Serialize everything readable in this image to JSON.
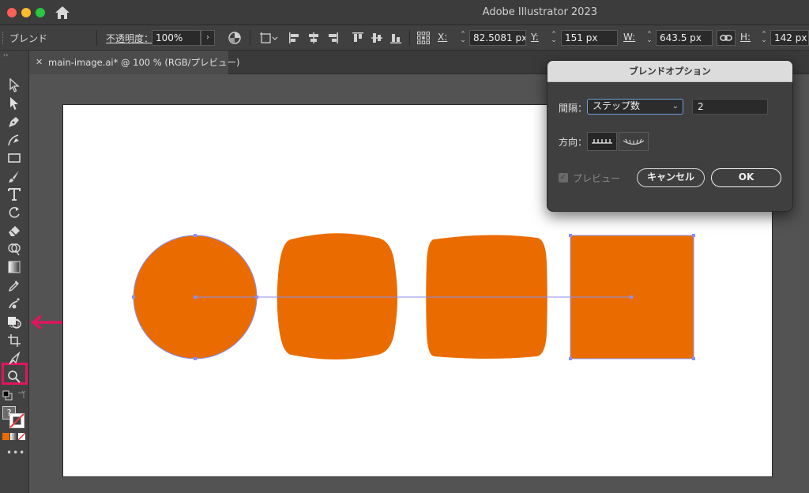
{
  "app": {
    "title": "Adobe Illustrator 2023"
  },
  "controlbar": {
    "selection_label": "ブレンド",
    "opacity_label": "不透明度：",
    "opacity_value": "100%",
    "x_label": "X:",
    "x_value": "82.5081 px",
    "y_label": "Y:",
    "y_value": "151 px",
    "w_label": "W:",
    "w_value": "643.5 px",
    "h_label": "H:",
    "h_value": "142 px"
  },
  "document": {
    "tab_title": "main-image.ai* @ 100 % (RGB/プレビュー)"
  },
  "colors": {
    "orange": "#EA6C00",
    "path": "#8b8ef2",
    "highlight": "#e0145f",
    "stroke_none": "#e63b3b"
  },
  "dialog": {
    "title": "ブレンドオプション",
    "spacing_label": "間隔：",
    "spacing_option": "ステップ数",
    "steps_value": "2",
    "orientation_label": "方向：",
    "preview_label": "プレビュー",
    "cancel_label": "キャンセル",
    "ok_label": "OK"
  }
}
